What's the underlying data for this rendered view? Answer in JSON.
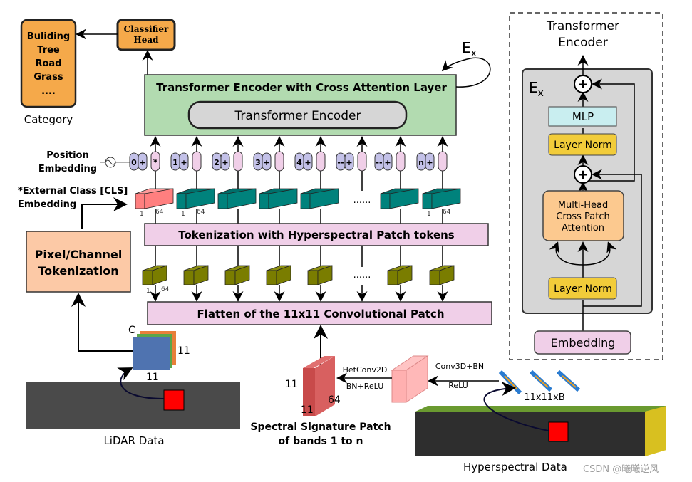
{
  "category": {
    "items": [
      "Buliding",
      "Tree",
      "Road",
      "Grass",
      "...."
    ],
    "label": "Category"
  },
  "classifier": {
    "line1": "Classifier",
    "line2": "Head"
  },
  "transformer": {
    "title": "Transformer Encoder with Cross Attention Layer",
    "inner": "Transformer Encoder",
    "loop_label": "E",
    "loop_sub": "x"
  },
  "position": {
    "line1": "Position",
    "line2": "Embedding"
  },
  "tokens": {
    "labels": [
      "0",
      "1",
      "2",
      "3",
      "4",
      "--",
      "--",
      "n"
    ],
    "cls_symbol": "*",
    "plus": "+",
    "dots": "......"
  },
  "cls": {
    "line1": "*External Class [CLS]",
    "line2": "Embedding"
  },
  "dims": {
    "one": "1",
    "sixtyfour": "64",
    "eleven": "11",
    "c": "C"
  },
  "tokenization_bar": "Tokenization with Hyperspectral Patch tokens",
  "pixel_box": {
    "line1": "Pixel/Channel",
    "line2": "Tokenization"
  },
  "flatten_bar": "Flatten of the 11x11 Convolutional Patch",
  "lidar": {
    "label": "LiDAR Data"
  },
  "spectral": {
    "line1": "Spectral Signature Patch",
    "line2": "of bands 1 to n",
    "het_top": "HetConv2D",
    "het_bottom": "BN+ReLU",
    "conv_top": "Conv3D+BN",
    "conv_bottom": "ReLU",
    "patch_size": "11x11xB"
  },
  "hyperspectral": {
    "label": "Hyperspectral Data",
    "watermark": "CSDN @曦曦逆风"
  },
  "encoder_panel": {
    "title1": "Transformer",
    "title2": "Encoder",
    "ex": "E",
    "ex_sub": "x",
    "mlp": "MLP",
    "norm_top": "Layer Norm",
    "attention": [
      "Multi-Head",
      "Cross Patch",
      "Attention"
    ],
    "norm_bottom": "Layer Norm",
    "embedding": "Embedding"
  },
  "colors": {
    "orange": "#f5a94a",
    "green": "#b2dbb0",
    "pink": "#f0cfe8",
    "teal": "#00827c",
    "olive": "#7a7d00",
    "lavender": "#c3c1e8",
    "peach": "#fcc9a6"
  }
}
